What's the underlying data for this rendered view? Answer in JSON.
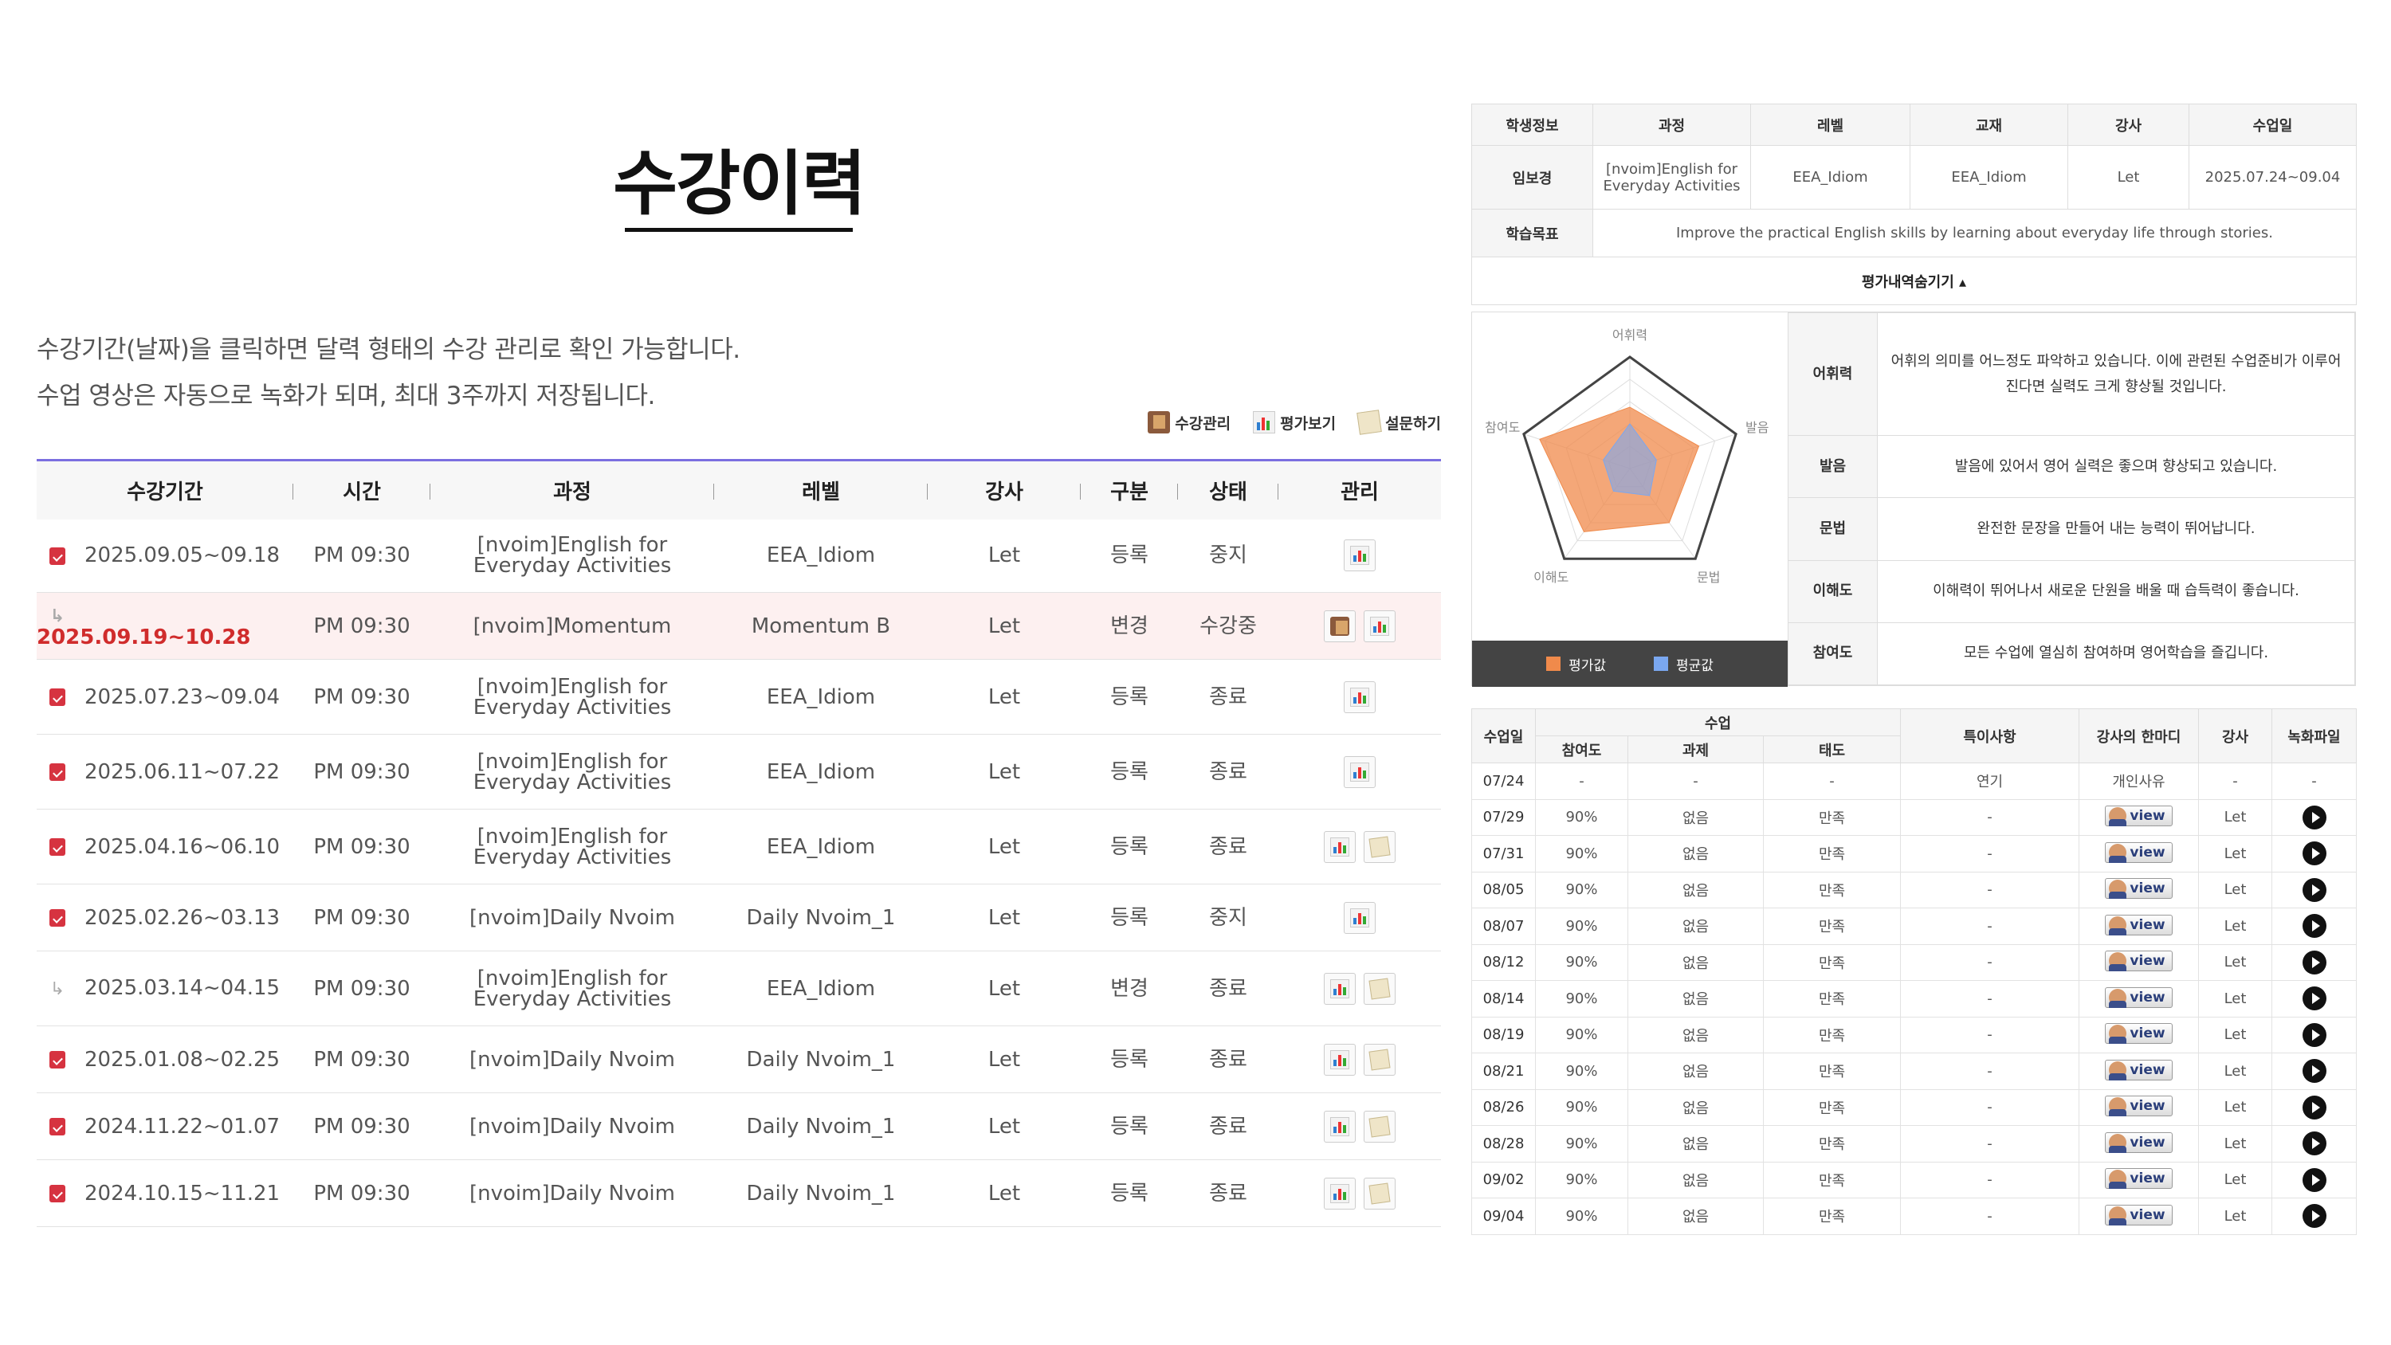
{
  "page": {
    "title": "수강이력",
    "desc1": "수강기간(날짜)을 클릭하면 달력 형태의 수강 관리로 확인 가능합니다.",
    "desc2": "수업 영상은 자동으로 녹화가 되며, 최대 3주까지 저장됩니다."
  },
  "actions": {
    "manage": "수강관리",
    "eval": "평가보기",
    "survey": "설문하기"
  },
  "history": {
    "headers": [
      "수강기간",
      "시간",
      "과정",
      "레벨",
      "강사",
      "구분",
      "상태",
      "관리"
    ],
    "rows": [
      {
        "icon": "calendar",
        "period": "2025.09.05~09.18",
        "time": "PM 09:30",
        "course": "[nvoim]English for Everyday Activities",
        "level": "EEA_Idiom",
        "teacher": "Let",
        "type": "등록",
        "status": "중지",
        "buttons": [
          "chart"
        ]
      },
      {
        "icon": "arrow",
        "period": "2025.09.19~10.28",
        "time": "PM 09:30",
        "course": "[nvoim]Momentum",
        "level": "Momentum B",
        "teacher": "Let",
        "type": "변경",
        "status": "수강중",
        "buttons": [
          "book",
          "chart"
        ],
        "active": true
      },
      {
        "icon": "calendar",
        "period": "2025.07.23~09.04",
        "time": "PM 09:30",
        "course": "[nvoim]English for Everyday Activities",
        "level": "EEA_Idiom",
        "teacher": "Let",
        "type": "등록",
        "status": "종료",
        "buttons": [
          "chart"
        ]
      },
      {
        "icon": "calendar",
        "period": "2025.06.11~07.22",
        "time": "PM 09:30",
        "course": "[nvoim]English for Everyday Activities",
        "level": "EEA_Idiom",
        "teacher": "Let",
        "type": "등록",
        "status": "종료",
        "buttons": [
          "chart"
        ]
      },
      {
        "icon": "calendar",
        "period": "2025.04.16~06.10",
        "time": "PM 09:30",
        "course": "[nvoim]English for Everyday Activities",
        "level": "EEA_Idiom",
        "teacher": "Let",
        "type": "등록",
        "status": "종료",
        "buttons": [
          "chart",
          "paper"
        ]
      },
      {
        "icon": "calendar",
        "period": "2025.02.26~03.13",
        "time": "PM 09:30",
        "course": "[nvoim]Daily Nvoim",
        "level": "Daily Nvoim_1",
        "teacher": "Let",
        "type": "등록",
        "status": "중지",
        "buttons": [
          "chart"
        ]
      },
      {
        "icon": "arrow",
        "period": "2025.03.14~04.15",
        "time": "PM 09:30",
        "course": "[nvoim]English for Everyday Activities",
        "level": "EEA_Idiom",
        "teacher": "Let",
        "type": "변경",
        "status": "종료",
        "buttons": [
          "chart",
          "paper"
        ]
      },
      {
        "icon": "calendar",
        "period": "2025.01.08~02.25",
        "time": "PM 09:30",
        "course": "[nvoim]Daily Nvoim",
        "level": "Daily Nvoim_1",
        "teacher": "Let",
        "type": "등록",
        "status": "종료",
        "buttons": [
          "chart",
          "paper"
        ]
      },
      {
        "icon": "calendar",
        "period": "2024.11.22~01.07",
        "time": "PM 09:30",
        "course": "[nvoim]Daily Nvoim",
        "level": "Daily Nvoim_1",
        "teacher": "Let",
        "type": "등록",
        "status": "종료",
        "buttons": [
          "chart",
          "paper"
        ]
      },
      {
        "icon": "calendar",
        "period": "2024.10.15~11.21",
        "time": "PM 09:30",
        "course": "[nvoim]Daily Nvoim",
        "level": "Daily Nvoim_1",
        "teacher": "Let",
        "type": "등록",
        "status": "종료",
        "buttons": [
          "chart",
          "paper"
        ]
      }
    ]
  },
  "student": {
    "headers": [
      "학생정보",
      "과정",
      "레벨",
      "교재",
      "강사",
      "수업일"
    ],
    "name": "임보경",
    "course": "[nvoim]English for Everyday Activities",
    "level": "EEA_Idiom",
    "book": "EEA_Idiom",
    "teacher": "Let",
    "dates": "2025.07.24~09.04",
    "goal_label": "학습목표",
    "goal": "Improve the practical English skills by learning about everyday life through stories.",
    "toggle": "평가내역숨기기 ▴"
  },
  "evaluation": {
    "axes": [
      "어휘력",
      "발음",
      "문법",
      "이해도",
      "참여도"
    ],
    "legend": [
      "평가값",
      "평균값"
    ],
    "colors": {
      "score": "#f08a4b",
      "average": "#7aa7f0"
    },
    "score": [
      0.55,
      0.65,
      0.6,
      0.7,
      0.85
    ],
    "average": [
      0.4,
      0.25,
      0.3,
      0.25,
      0.25
    ],
    "comments": [
      {
        "category": "어휘력",
        "text": "어휘의 의미를 어느정도 파악하고 있습니다. 이에 관련된 수업준비가 이루어진다면 실력도 크게 향상될 것입니다."
      },
      {
        "category": "발음",
        "text": "발음에 있어서 영어 실력은 좋으며 향상되고 있습니다."
      },
      {
        "category": "문법",
        "text": "완전한 문장을 만들어 내는 능력이 뛰어납니다."
      },
      {
        "category": "이해도",
        "text": "이해력이 뛰어나서 새로운 단원을 배울 때 습득력이 좋습니다."
      },
      {
        "category": "참여도",
        "text": "모든 수업에 열심히 참여하며 영어학습을 즐깁니다."
      }
    ]
  },
  "attendance": {
    "h_date": "수업일",
    "h_class": "수업",
    "h_part": "참여도",
    "h_hw": "과제",
    "h_attitude": "태도",
    "h_notes": "특이사항",
    "h_comment": "강사의 한마디",
    "h_teacher": "강사",
    "h_rec": "녹화파일",
    "view_label": "view",
    "rows": [
      {
        "date": "07/24",
        "part": "-",
        "hw": "-",
        "att": "-",
        "note": "연기",
        "comment": "개인사유",
        "teacher": "-",
        "rec": "-"
      },
      {
        "date": "07/29",
        "part": "90%",
        "hw": "없음",
        "att": "만족",
        "note": "-",
        "comment": "view",
        "teacher": "Let",
        "rec": "play"
      },
      {
        "date": "07/31",
        "part": "90%",
        "hw": "없음",
        "att": "만족",
        "note": "-",
        "comment": "view",
        "teacher": "Let",
        "rec": "play"
      },
      {
        "date": "08/05",
        "part": "90%",
        "hw": "없음",
        "att": "만족",
        "note": "-",
        "comment": "view",
        "teacher": "Let",
        "rec": "play"
      },
      {
        "date": "08/07",
        "part": "90%",
        "hw": "없음",
        "att": "만족",
        "note": "-",
        "comment": "view",
        "teacher": "Let",
        "rec": "play"
      },
      {
        "date": "08/12",
        "part": "90%",
        "hw": "없음",
        "att": "만족",
        "note": "-",
        "comment": "view",
        "teacher": "Let",
        "rec": "play"
      },
      {
        "date": "08/14",
        "part": "90%",
        "hw": "없음",
        "att": "만족",
        "note": "-",
        "comment": "view",
        "teacher": "Let",
        "rec": "play"
      },
      {
        "date": "08/19",
        "part": "90%",
        "hw": "없음",
        "att": "만족",
        "note": "-",
        "comment": "view",
        "teacher": "Let",
        "rec": "play"
      },
      {
        "date": "08/21",
        "part": "90%",
        "hw": "없음",
        "att": "만족",
        "note": "-",
        "comment": "view",
        "teacher": "Let",
        "rec": "play"
      },
      {
        "date": "08/26",
        "part": "90%",
        "hw": "없음",
        "att": "만족",
        "note": "-",
        "comment": "view",
        "teacher": "Let",
        "rec": "play"
      },
      {
        "date": "08/28",
        "part": "90%",
        "hw": "없음",
        "att": "만족",
        "note": "-",
        "comment": "view",
        "teacher": "Let",
        "rec": "play"
      },
      {
        "date": "09/02",
        "part": "90%",
        "hw": "없음",
        "att": "만족",
        "note": "-",
        "comment": "view",
        "teacher": "Let",
        "rec": "play"
      },
      {
        "date": "09/04",
        "part": "90%",
        "hw": "없음",
        "att": "만족",
        "note": "-",
        "comment": "view",
        "teacher": "Let",
        "rec": "play"
      }
    ]
  }
}
